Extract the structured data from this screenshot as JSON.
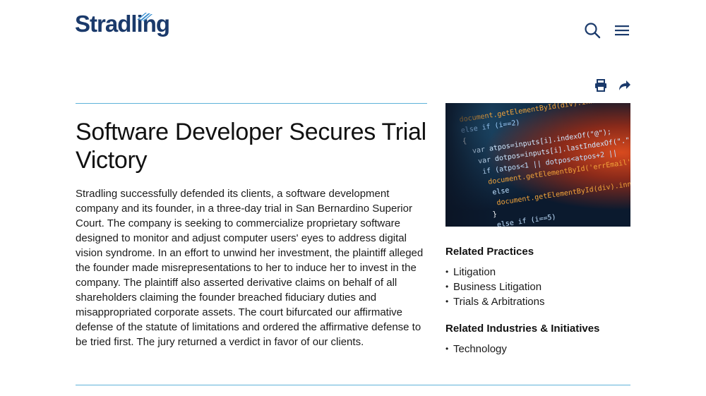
{
  "brand": {
    "name": "Stradling",
    "color": "#1b3a6b",
    "accent": "#3a8fd0"
  },
  "header": {
    "search_icon": "search-icon",
    "menu_icon": "hamburger-menu-icon"
  },
  "tools": {
    "print_icon": "print-icon",
    "share_icon": "share-arrow-icon"
  },
  "article": {
    "title": "Software Developer Secures Trial Victory",
    "body": "Stradling successfully defended its clients, a software development company and its founder, in a three-day trial in San Bernardino Superior Court. The company is seeking to commercialize proprietary software designed to monitor and adjust computer users' eyes to address digital vision syndrome. In an effort to unwind her investment, the plaintiff alleged the founder made misrepresentations to her to induce her to invest in the company. The plaintiff also asserted derivative claims on behalf of all shareholders claiming the founder breached fiduciary duties and misappropriated corporate assets. The court bifurcated our affirmative defense of the statute of limitations and ordered the affirmative defense to be tried first. The jury returned a verdict in favor of our clients."
  },
  "side_image": {
    "code_lines": [
      "document.getElementById(div).innerHTML = error;",
      "else if (i==2)",
      "{",
      "var atpos=inputs[i].indexOf(\"@\");",
      "var dotpos=inputs[i].lastIndexOf(\".\");",
      "if (atpos<1 || dotpos<atpos+2 ||",
      "document.getElementById('errEmail').",
      "else",
      "document.getElementById(div).innerHTML",
      "}",
      "else if (i==5)"
    ]
  },
  "related_practices": {
    "heading": "Related Practices",
    "items": [
      "Litigation",
      "Business Litigation",
      "Trials & Arbitrations"
    ]
  },
  "related_industries": {
    "heading": "Related Industries & Initiatives",
    "items": [
      "Technology"
    ]
  },
  "colors": {
    "rule": "#5fb3d9",
    "icon": "#1b3a6b"
  }
}
